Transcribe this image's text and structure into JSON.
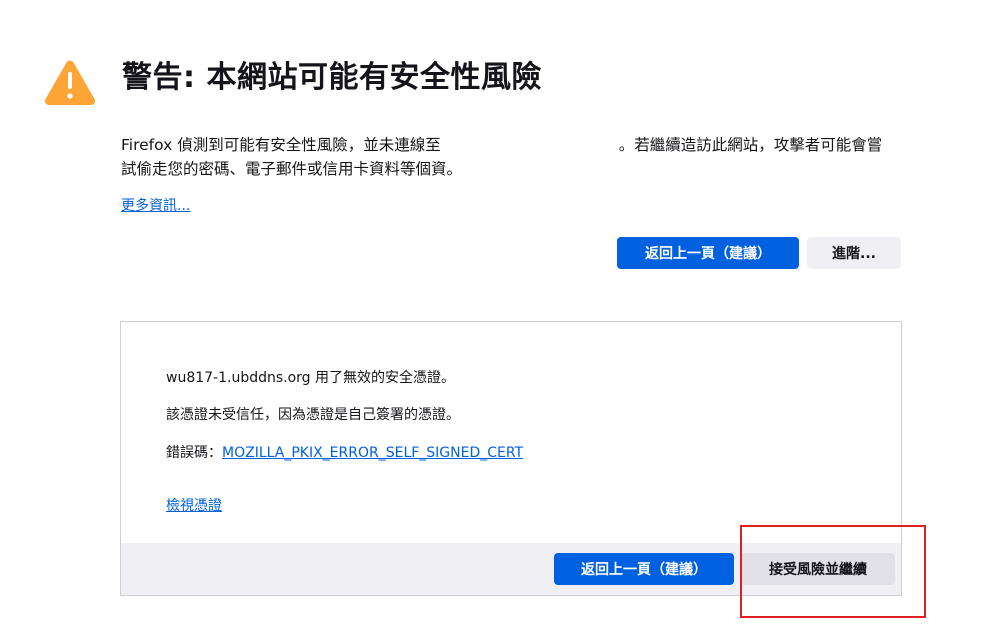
{
  "header": {
    "icon": "warning-triangle-icon",
    "icon_color": "#ffa436",
    "title": "警告: 本網站可能有安全性風險"
  },
  "intro": {
    "text_before": "Firefox 偵測到可能有安全性風險，並未連線至",
    "text_after": "。若繼續造訪此網站，攻擊者可能會嘗試偷走您的密碼、電子郵件或信用卡資料等個資。"
  },
  "learn_more_label": "更多資訊...",
  "actions": {
    "go_back_label": "返回上一頁（建議）",
    "advanced_label": "進階..."
  },
  "advanced_panel": {
    "host_line": "wu817-1.ubddns.org 用了無效的安全憑證。",
    "trust_line": "該憑證未受信任，因為憑證是自己簽署的憑證。",
    "error_code_prefix": "錯誤碼：",
    "error_code": "MOZILLA_PKIX_ERROR_SELF_SIGNED_CERT",
    "view_certificate_label": "檢視憑證",
    "go_back_label": "返回上一頁（建議）",
    "accept_risk_label": "接受風險並繼續"
  },
  "colors": {
    "accent": "#0061e0",
    "highlight_border": "#e0201f"
  }
}
